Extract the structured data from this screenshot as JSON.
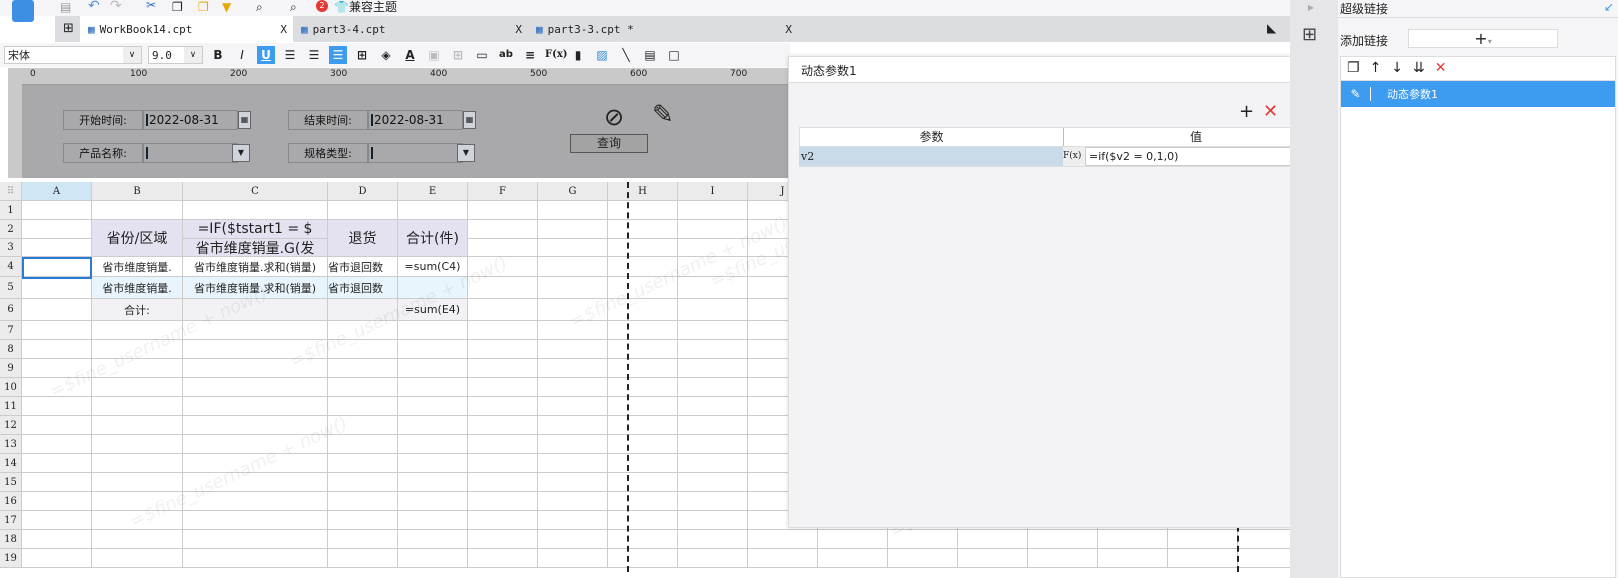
{
  "toolbar": {
    "compat_theme": "兼容主题",
    "badge": "2"
  },
  "tabs": [
    {
      "label": "WorkBook14.cpt"
    },
    {
      "label": "part3-4.cpt"
    },
    {
      "label": "part3-3.cpt *"
    }
  ],
  "format": {
    "font": "宋体",
    "size": "9.0",
    "bold": "B",
    "italic": "I",
    "underline": "U",
    "fx": "F(x)",
    "ab": "ab"
  },
  "ruler": [
    "0",
    "100",
    "200",
    "300",
    "400",
    "500",
    "600",
    "700"
  ],
  "params": {
    "start_label": "开始时间:",
    "start_value": "2022-08-31",
    "end_label": "结束时间:",
    "end_value": "2022-08-31",
    "product_label": "产品名称:",
    "spec_label": "规格类型:",
    "query": "查询"
  },
  "columns": [
    "A",
    "B",
    "C",
    "D",
    "E",
    "F",
    "G",
    "H",
    "I",
    "J"
  ],
  "rows": [
    "1",
    "2",
    "3",
    "4",
    "5",
    "6",
    "7",
    "8",
    "9",
    "10",
    "11",
    "12",
    "13",
    "14",
    "15",
    "16",
    "17",
    "18",
    "19"
  ],
  "cells": {
    "b2": "省份/区域",
    "c2": "=IF($tstart1 = $",
    "c3": "省市维度销量.G(发",
    "d2": "退货",
    "e2": "合计(件)",
    "b4": "省市维度销量.",
    "c4": "省市维度销量.求和(销量)",
    "d4": "省市退回数",
    "e4": "=sum(C4)",
    "b5": "省市维度销量.",
    "c5": "省市维度销量.求和(销量)",
    "d5": "省市退回数",
    "b6": "合计:",
    "e6": "=sum(E4)"
  },
  "watermark": "=$fine_username + now()",
  "dialog": {
    "title": "动态参数1",
    "col_param": "参数",
    "col_value": "值",
    "row_param": "v2",
    "row_value": "=if($v2 = 0,1,0)",
    "fx": "F(x)"
  },
  "right_panel": {
    "title": "超级链接",
    "add_label": "添加链接",
    "add_btn": "+",
    "items": [
      {
        "label": "动态参数1"
      }
    ]
  },
  "colors": {
    "accent": "#3d9cf0",
    "delete": "#e53935",
    "selection": "#2b7ad8"
  }
}
